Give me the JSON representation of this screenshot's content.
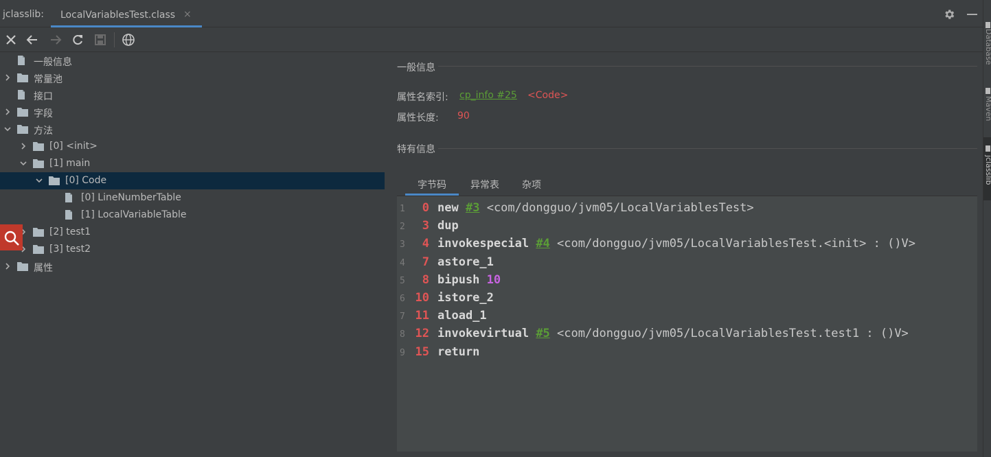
{
  "titlebar": {
    "app_label": "jclasslib:",
    "tab_label": "LocalVariablesTest.class",
    "close_glyph": "×"
  },
  "right_strip": {
    "labels": [
      "Database",
      "Maven",
      "jclasslib"
    ]
  },
  "tree": {
    "nodes": [
      {
        "label": "一般信息",
        "level": 0,
        "kind": "file",
        "arrow": "none"
      },
      {
        "label": "常量池",
        "level": 0,
        "kind": "folder",
        "arrow": "right"
      },
      {
        "label": "接口",
        "level": 0,
        "kind": "file",
        "arrow": "none"
      },
      {
        "label": "字段",
        "level": 0,
        "kind": "folder",
        "arrow": "right"
      },
      {
        "label": "方法",
        "level": 0,
        "kind": "folder",
        "arrow": "down"
      },
      {
        "label": "[0] <init>",
        "level": 1,
        "kind": "folder",
        "arrow": "right"
      },
      {
        "label": "[1] main",
        "level": 1,
        "kind": "folder",
        "arrow": "down"
      },
      {
        "label": "[0] Code",
        "level": 2,
        "kind": "folder",
        "arrow": "down",
        "selected": true
      },
      {
        "label": "[0] LineNumberTable",
        "level": 3,
        "kind": "file",
        "arrow": "none"
      },
      {
        "label": "[1] LocalVariableTable",
        "level": 3,
        "kind": "file",
        "arrow": "none"
      },
      {
        "label": "[2] test1",
        "level": 1,
        "kind": "folder",
        "arrow": "right"
      },
      {
        "label": "[3] test2",
        "level": 1,
        "kind": "folder",
        "arrow": "right"
      },
      {
        "label": "属性",
        "level": 0,
        "kind": "folder",
        "arrow": "right"
      }
    ]
  },
  "panel": {
    "general_title": "一般信息",
    "name_index_label": "属性名索引:",
    "name_index_link": "cp_info #25",
    "name_index_value": "<Code>",
    "length_label": "属性长度:",
    "length_value": "90",
    "specific_title": "特有信息",
    "subtabs": [
      "字节码",
      "异常表",
      "杂项"
    ]
  },
  "bytecode": [
    {
      "ln": "1",
      "off": "0",
      "op": "new",
      "ref": "#3",
      "cmt": "<com/dongguo/jvm05/LocalVariablesTest>"
    },
    {
      "ln": "2",
      "off": "3",
      "op": "dup"
    },
    {
      "ln": "3",
      "off": "4",
      "op": "invokespecial",
      "ref": "#4",
      "cmt": "<com/dongguo/jvm05/LocalVariablesTest.<init> : ()V>"
    },
    {
      "ln": "4",
      "off": "7",
      "op": "astore_1"
    },
    {
      "ln": "5",
      "off": "8",
      "op": "bipush",
      "num": "10"
    },
    {
      "ln": "6",
      "off": "10",
      "op": "istore_2"
    },
    {
      "ln": "7",
      "off": "11",
      "op": "aload_1"
    },
    {
      "ln": "8",
      "off": "12",
      "op": "invokevirtual",
      "ref": "#5",
      "cmt": "<com/dongguo/jvm05/LocalVariablesTest.test1 : ()V>"
    },
    {
      "ln": "9",
      "off": "15",
      "op": "return"
    }
  ],
  "colors": {
    "accent": "#4a88c7",
    "selection": "#0d293e",
    "offset_red": "#e05555",
    "link_green": "#5b9e36",
    "number_purple": "#c764e0"
  }
}
